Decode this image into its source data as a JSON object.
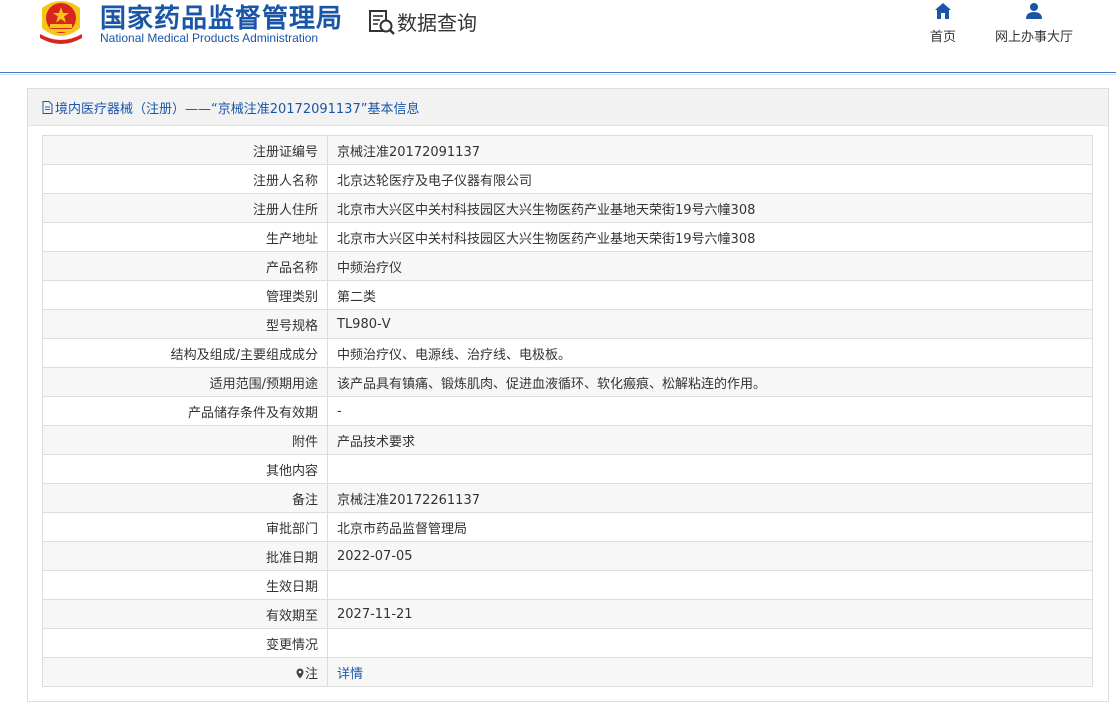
{
  "header": {
    "brand_cn": "国家药品监督管理局",
    "brand_en": "National Medical Products Administration",
    "query_title": "数据查询",
    "nav": {
      "home": "首页",
      "office": "网上办事大厅"
    }
  },
  "panel": {
    "title": "境内医疗器械（注册）——“京械注准20172091137”基本信息"
  },
  "rows": [
    {
      "label": "注册证编号",
      "value": "京械注准20172091137"
    },
    {
      "label": "注册人名称",
      "value": "北京达轮医疗及电子仪器有限公司"
    },
    {
      "label": "注册人住所",
      "value": "北京市大兴区中关村科技园区大兴生物医药产业基地天荣街19号六幢308"
    },
    {
      "label": "生产地址",
      "value": "北京市大兴区中关村科技园区大兴生物医药产业基地天荣街19号六幢308"
    },
    {
      "label": "产品名称",
      "value": "中频治疗仪"
    },
    {
      "label": "管理类别",
      "value": "第二类"
    },
    {
      "label": "型号规格",
      "value": "TL980-Ⅴ"
    },
    {
      "label": "结构及组成/主要组成成分",
      "value": "中频治疗仪、电源线、治疗线、电极板。"
    },
    {
      "label": "适用范围/预期用途",
      "value": "该产品具有镇痛、锻炼肌肉、促进血液循环、软化瘢痕、松解粘连的作用。"
    },
    {
      "label": "产品储存条件及有效期",
      "value": "-"
    },
    {
      "label": "附件",
      "value": "产品技术要求"
    },
    {
      "label": "其他内容",
      "value": ""
    },
    {
      "label": "备注",
      "value": "京械注准20172261137"
    },
    {
      "label": "审批部门",
      "value": "北京市药品监督管理局"
    },
    {
      "label": "批准日期",
      "value": "2022-07-05"
    },
    {
      "label": "生效日期",
      "value": ""
    },
    {
      "label": "有效期至",
      "value": "2027-11-21"
    },
    {
      "label": "变更情况",
      "value": ""
    },
    {
      "label": "注",
      "value": "详情"
    }
  ],
  "colors": {
    "brand_blue": "#1a56a8",
    "header_line": "#3f7cc4",
    "emblem_red": "#d9261c",
    "emblem_gold": "#f5c518"
  }
}
